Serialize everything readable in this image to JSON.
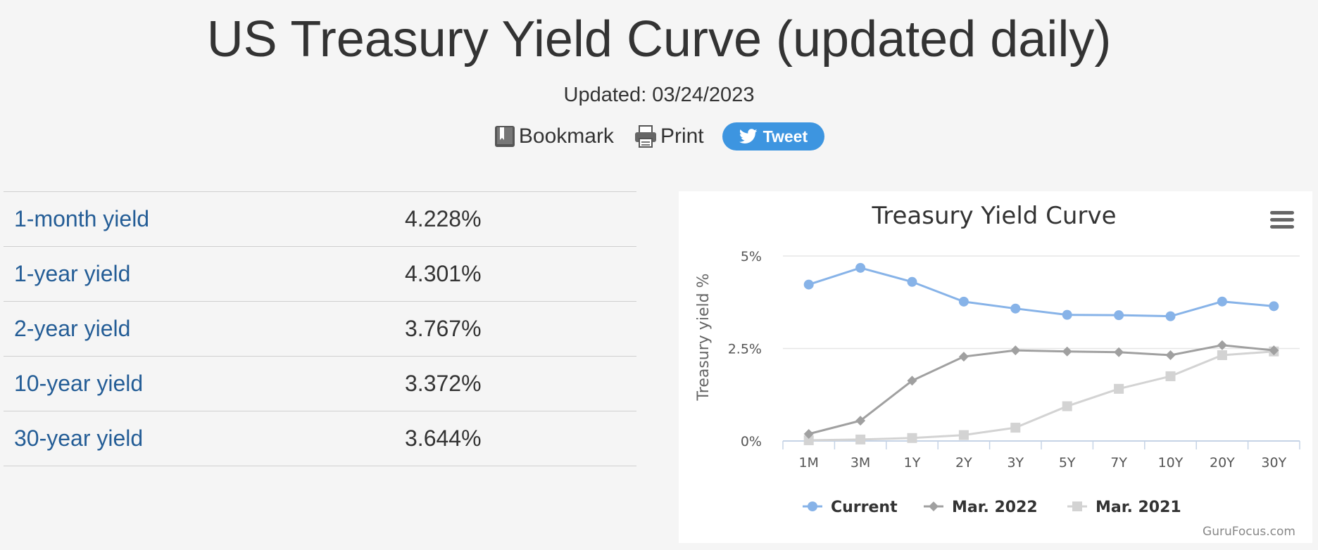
{
  "page": {
    "title": "US Treasury Yield Curve (updated daily)",
    "updated": "Updated: 03/24/2023"
  },
  "share": {
    "bookmark_label": "Bookmark",
    "print_label": "Print",
    "tweet_label": "Tweet"
  },
  "yields": [
    {
      "label": "1-month yield",
      "value": "4.228%"
    },
    {
      "label": "1-year yield",
      "value": "4.301%"
    },
    {
      "label": "2-year yield",
      "value": "3.767%"
    },
    {
      "label": "10-year yield",
      "value": "3.372%"
    },
    {
      "label": "30-year yield",
      "value": "3.644%"
    }
  ],
  "chart_data": {
    "type": "line",
    "title": "Treasury Yield Curve",
    "xlabel": "",
    "ylabel": "Treasury yield %",
    "categories": [
      "1M",
      "3M",
      "1Y",
      "2Y",
      "3Y",
      "5Y",
      "7Y",
      "10Y",
      "20Y",
      "30Y"
    ],
    "y_ticks": [
      "0%",
      "2.5%",
      "5%"
    ],
    "ylim": [
      0,
      5
    ],
    "grid": true,
    "legend": "bottom",
    "credit": "GuruFocus.com",
    "series": [
      {
        "name": "Current",
        "marker": "circle",
        "color": "#87b3e8",
        "values": [
          4.228,
          4.68,
          4.301,
          3.767,
          3.58,
          3.41,
          3.4,
          3.372,
          3.77,
          3.644
        ]
      },
      {
        "name": "Mar. 2022",
        "marker": "diamond",
        "color": "#a0a0a0",
        "values": [
          0.19,
          0.55,
          1.63,
          2.28,
          2.45,
          2.42,
          2.4,
          2.32,
          2.59,
          2.45
        ]
      },
      {
        "name": "Mar. 2021",
        "marker": "square",
        "color": "#d3d3d3",
        "values": [
          0.02,
          0.04,
          0.08,
          0.16,
          0.36,
          0.94,
          1.41,
          1.75,
          2.32,
          2.42
        ]
      }
    ]
  }
}
